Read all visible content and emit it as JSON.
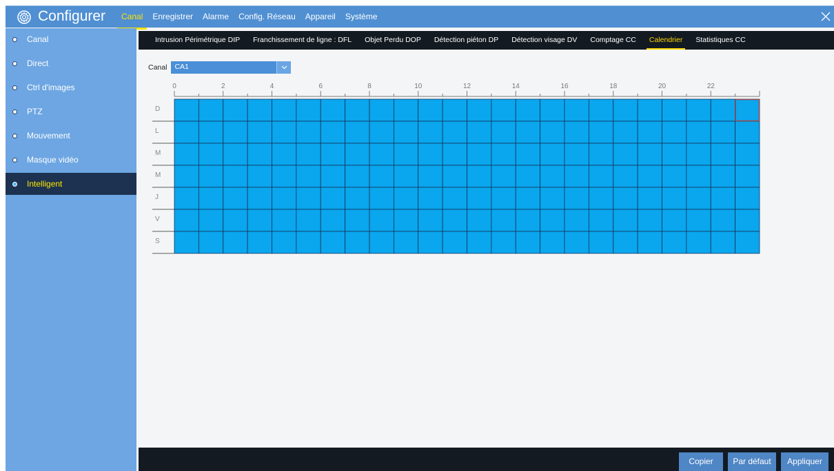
{
  "app": {
    "title": "Configurer",
    "main_menu": [
      "Canal",
      "Enregistrer",
      "Alarme",
      "Config. Réseau",
      "Appareil",
      "Système"
    ],
    "main_menu_active": 0
  },
  "sidebar": {
    "items": [
      {
        "label": "Canal"
      },
      {
        "label": "Direct"
      },
      {
        "label": "Ctrl d'images"
      },
      {
        "label": "PTZ"
      },
      {
        "label": "Mouvement"
      },
      {
        "label": "Masque vidéo"
      },
      {
        "label": "Intelligent"
      }
    ],
    "active_index": 6
  },
  "subtabs": {
    "items": [
      "Intrusion Périmétrique DIP",
      "Franchissement de ligne : DFL",
      "Objet Perdu DOP",
      "Détection piéton DP",
      "Détection visage DV",
      "Comptage CC",
      "Calendrier",
      "Statistiques CC"
    ],
    "active_index": 6
  },
  "schedule": {
    "channel_label": "Canal",
    "channel_value": "CA1",
    "hour_labels": [
      "0",
      "2",
      "4",
      "6",
      "8",
      "10",
      "12",
      "14",
      "16",
      "18",
      "20",
      "22"
    ],
    "days": [
      "D",
      "L",
      "M",
      "M",
      "J",
      "V",
      "S"
    ],
    "slots_per_day": 24,
    "all_slots_enabled": true,
    "selected_slot": {
      "day": 0,
      "hour": 23
    }
  },
  "colors": {
    "topbar": "#4f8fd2",
    "active_accent": "#ffe200",
    "schedule_fill": "#0aa6ee",
    "schedule_line": "#12345a"
  },
  "buttons": {
    "copy": "Copier",
    "default": "Par défaut",
    "apply": "Appliquer"
  }
}
